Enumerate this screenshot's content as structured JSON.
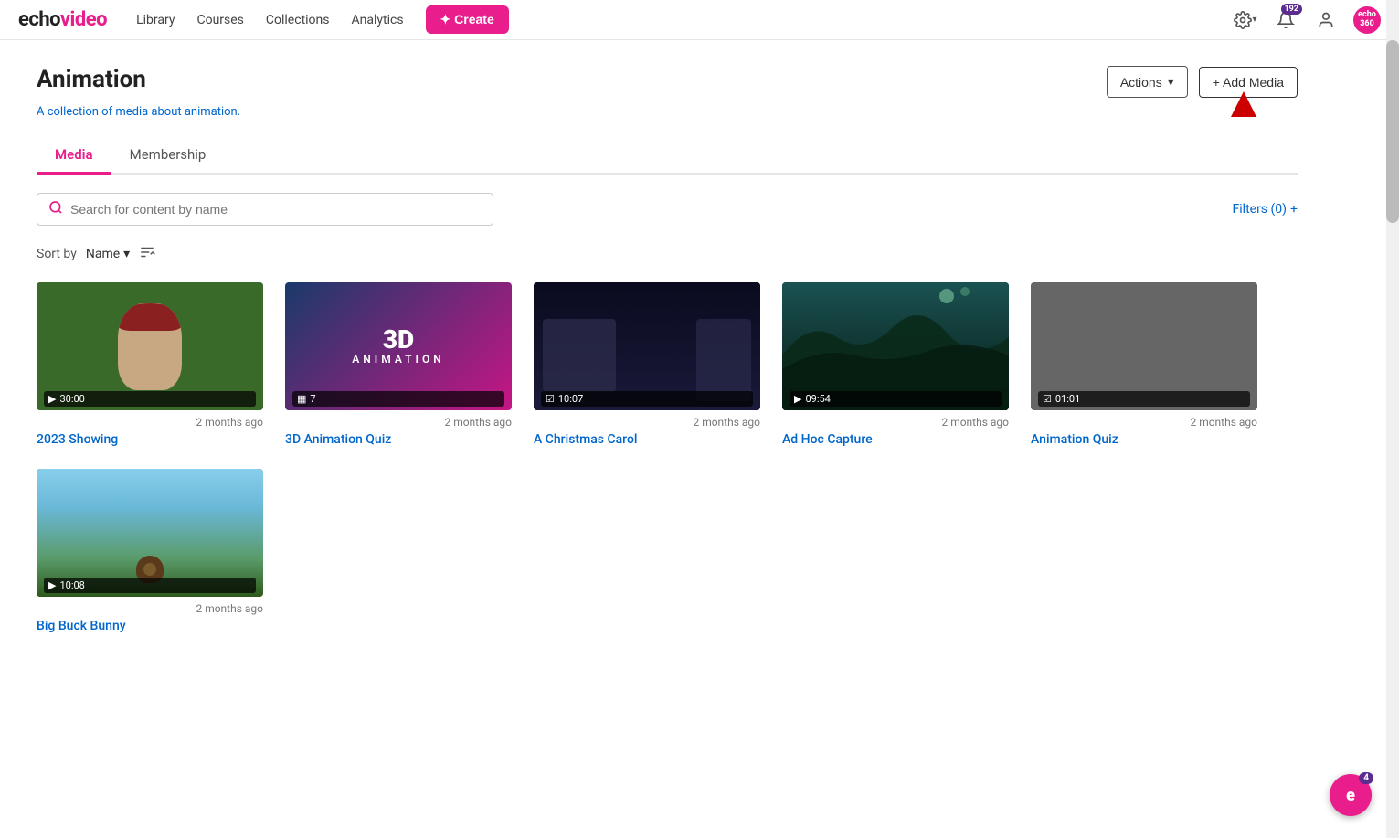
{
  "logo": {
    "text_echo": "echo",
    "text_video": "video"
  },
  "navbar": {
    "links": [
      {
        "label": "Library",
        "id": "library"
      },
      {
        "label": "Courses",
        "id": "courses"
      },
      {
        "label": "Collections",
        "id": "collections"
      },
      {
        "label": "Analytics",
        "id": "analytics"
      }
    ],
    "create_label": "✦ Create",
    "notification_count": "192",
    "echo360_label": "echo\n360"
  },
  "page": {
    "title": "Animation",
    "subtitle": "A collection of media about animation.",
    "actions_label": "Actions",
    "add_media_label": "+ Add Media"
  },
  "tabs": [
    {
      "label": "Media",
      "id": "media",
      "active": true
    },
    {
      "label": "Membership",
      "id": "membership",
      "active": false
    }
  ],
  "search": {
    "placeholder": "Search for content by name",
    "filters_label": "Filters (0)",
    "filters_icon": "+"
  },
  "sort": {
    "label": "Sort by",
    "value": "Name"
  },
  "media_items": [
    {
      "id": 1,
      "title": "2023 Showing",
      "date": "2 months ago",
      "duration": "30:00",
      "type": "video",
      "thumb_class": "thumb-1"
    },
    {
      "id": 2,
      "title": "3D Animation Quiz",
      "date": "2 months ago",
      "duration": "7",
      "type": "slides",
      "thumb_class": "thumb-2"
    },
    {
      "id": 3,
      "title": "A Christmas Carol",
      "date": "2 months ago",
      "duration": "10:07",
      "type": "quiz",
      "thumb_class": "thumb-3"
    },
    {
      "id": 4,
      "title": "Ad Hoc Capture",
      "date": "2 months ago",
      "duration": "09:54",
      "type": "video",
      "thumb_class": "thumb-4"
    },
    {
      "id": 5,
      "title": "Animation Quiz",
      "date": "2 months ago",
      "duration": "01:01",
      "type": "quiz",
      "thumb_class": "thumb-5"
    },
    {
      "id": 6,
      "title": "Big Buck Bunny",
      "date": "2 months ago",
      "duration": "10:08",
      "type": "video",
      "thumb_class": "thumb-6"
    }
  ],
  "chat_badge": "4",
  "colors": {
    "accent": "#e91e8c",
    "link": "#0066cc",
    "purple": "#5c2d91"
  }
}
